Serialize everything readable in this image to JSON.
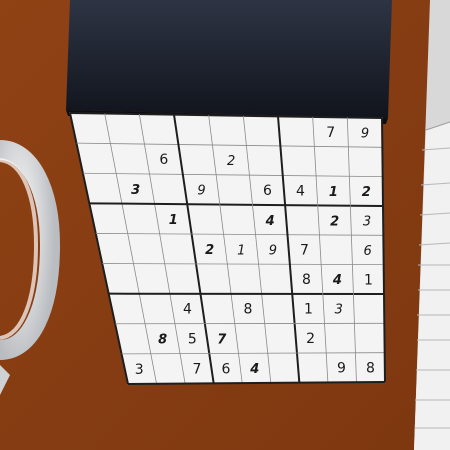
{
  "game": {
    "name": "sudoku",
    "cell_fill": "#f4f4f4",
    "cells": [
      [
        null,
        null,
        null,
        null,
        null,
        null,
        null,
        7,
        9
      ],
      [
        null,
        null,
        6,
        null,
        2,
        null,
        null,
        null,
        null
      ],
      [
        null,
        3,
        null,
        9,
        null,
        6,
        4,
        1,
        2
      ],
      [
        null,
        null,
        1,
        null,
        null,
        4,
        null,
        2,
        3
      ],
      [
        null,
        null,
        null,
        2,
        1,
        9,
        7,
        null,
        6
      ],
      [
        null,
        null,
        null,
        null,
        null,
        null,
        8,
        4,
        1
      ],
      [
        null,
        null,
        4,
        null,
        8,
        null,
        1,
        3,
        null
      ],
      [
        null,
        8,
        5,
        7,
        null,
        null,
        2,
        null,
        null
      ],
      [
        3,
        null,
        7,
        6,
        4,
        null,
        null,
        9,
        8
      ]
    ],
    "cell_style": [
      [
        null,
        null,
        null,
        null,
        null,
        null,
        null,
        "n",
        "i"
      ],
      [
        null,
        null,
        "n",
        null,
        "i",
        null,
        null,
        null,
        null
      ],
      [
        null,
        "b",
        null,
        "i",
        null,
        "n",
        "n",
        "b",
        "b"
      ],
      [
        null,
        null,
        "b",
        null,
        null,
        "b",
        null,
        "b",
        "i"
      ],
      [
        null,
        null,
        null,
        "b",
        "i",
        "i",
        "n",
        null,
        "i"
      ],
      [
        null,
        null,
        null,
        null,
        null,
        null,
        "n",
        "b",
        "n"
      ],
      [
        null,
        null,
        "n",
        null,
        "n",
        null,
        "n",
        "i",
        null
      ],
      [
        null,
        "b",
        "n",
        "b",
        null,
        null,
        "n",
        null,
        null
      ],
      [
        "n",
        null,
        "n",
        "n",
        "b",
        null,
        null,
        "n",
        "n"
      ]
    ]
  },
  "colors": {
    "table": "#8a3e12",
    "box_dark": "#1b1f2b",
    "mug": "#e2e4e6",
    "paper_right": "#f0f0f0",
    "digit": "#1a1a1a"
  }
}
